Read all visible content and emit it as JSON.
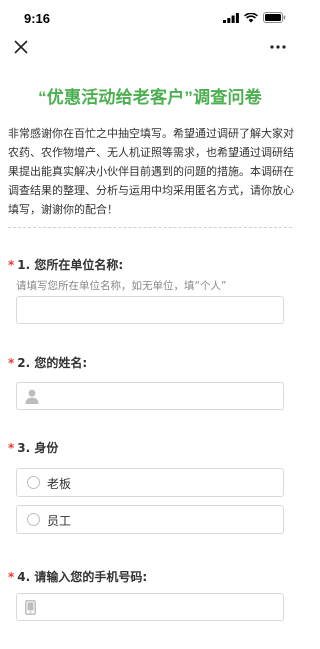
{
  "status_bar": {
    "time": "9:16"
  },
  "nav": {
    "close_icon": "close-icon",
    "more_icon": "more-icon"
  },
  "survey": {
    "title": "“优惠活动给老客户”调查问卷",
    "description": "非常感谢你在百忙之中抽空填写。希望通过调研了解大家对农药、农作物增产、无人机证照等需求，也希望通过调研结果提出能真实解决小伙伴目前遇到的问题的措施。本调研在调查结果的整理、分析与运用中均采用匿名方式，请你放心填写，谢谢你的配合！",
    "required_mark": "*",
    "questions": [
      {
        "label": "1. 您所在单位名称:",
        "hint": "请填写您所在单位名称，如无单位，填“个人”",
        "value": ""
      },
      {
        "label": "2. 您的姓名:",
        "icon": "person-icon",
        "value": ""
      },
      {
        "label": "3. 身份",
        "options": [
          "老板",
          "员工"
        ]
      },
      {
        "label": "4. 请输入您的手机号码:",
        "icon": "phone-icon",
        "value": ""
      }
    ]
  },
  "colors": {
    "accent": "#4caf50",
    "required": "#e53935",
    "background": "#f0f0f0"
  }
}
